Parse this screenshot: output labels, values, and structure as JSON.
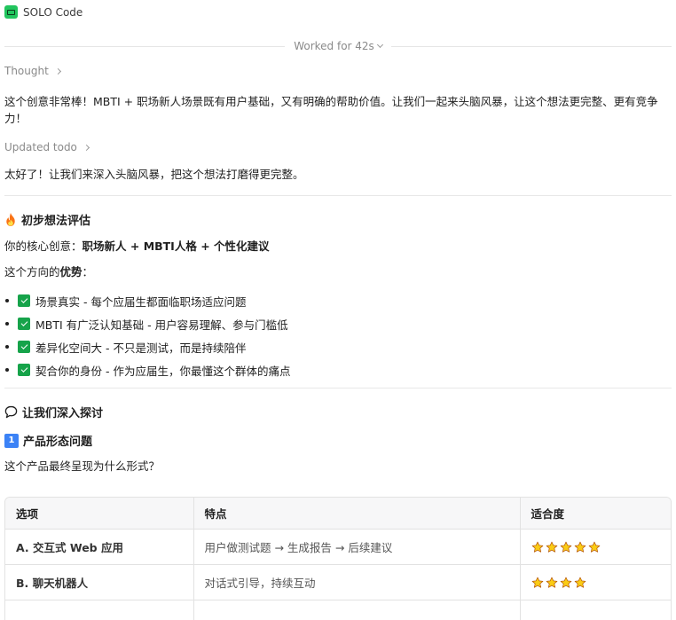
{
  "app": {
    "title": "SOLO Code"
  },
  "worked": {
    "label": "Worked for 42s"
  },
  "thought": {
    "label": "Thought"
  },
  "intro": {
    "text": "这个创意非常棒！MBTI + 职场新人场景既有用户基础，又有明确的帮助价值。让我们一起来头脑风暴，让这个想法更完整、更有竞争力！"
  },
  "todo": {
    "label": "Updated todo"
  },
  "intro2": {
    "text": "太好了！让我们来深入头脑风暴，把这个想法打磨得更完整。"
  },
  "eval": {
    "heading": "初步想法评估",
    "core_prefix": "你的核心创意：",
    "core_value": "职场新人 + MBTI人格 + 个性化建议",
    "adv_prefix": "这个方向的",
    "adv_bold": "优势",
    "adv_suffix": "：",
    "items": [
      "场景真实 - 每个应届生都面临职场适应问题",
      "MBTI 有广泛认知基础 - 用户容易理解、参与门槛低",
      "差异化空间大 - 不只是测试，而是持续陪伴",
      "契合你的身份 - 作为应届生，你最懂这个群体的痛点"
    ]
  },
  "explore": {
    "heading": "让我们深入探讨"
  },
  "q1": {
    "num": "1",
    "heading": "产品形态问题",
    "question": "这个产品最终呈现为什么形式？"
  },
  "table": {
    "headers": [
      "选项",
      "特点",
      "适合度"
    ],
    "rows": [
      {
        "option": "A. 交互式 Web 应用",
        "feature": "用户做测试题 → 生成报告 → 后续建议",
        "rating": 5
      },
      {
        "option": "B. 聊天机器人",
        "feature": "对话式引导，持续互动",
        "rating": 4
      }
    ]
  },
  "colors": {
    "accent_green": "#22c55e",
    "check_green": "#16a34a",
    "badge_blue": "#3b82f6",
    "star_yellow": "#facc15"
  }
}
